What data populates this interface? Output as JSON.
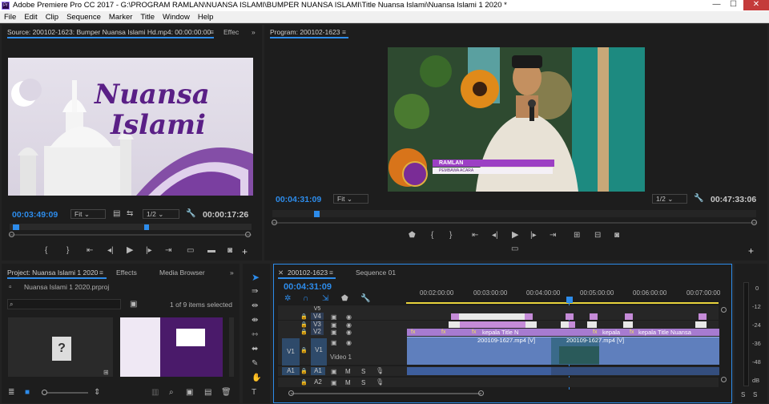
{
  "window": {
    "title": "Adobe Premiere Pro CC 2017 - G:\\PROGRAM RAMLAN\\NUANSA ISLAMI\\BUMPER NUANSA ISLAMI\\Title Nuansa Islami\\Nuansa Islami 1 2020 *",
    "minimize": "—",
    "maximize": "☐",
    "close": "✕",
    "icon": "Pr"
  },
  "menu": [
    "File",
    "Edit",
    "Clip",
    "Sequence",
    "Marker",
    "Title",
    "Window",
    "Help"
  ],
  "source": {
    "tab": "Source: 200102-1623: Bumper Nuansa Islami Hd.mp4: 00:00:00:00",
    "tab2": "Effec",
    "timecode": "00:03:49:09",
    "fit": "Fit",
    "resolution": "1/2",
    "duration": "00:00:17:26",
    "title_line1": "Nuansa",
    "title_line2": "Islami"
  },
  "program": {
    "tab": "Program: 200102-1623",
    "timecode": "00:04:31:09",
    "fit": "Fit",
    "resolution": "1/2",
    "duration": "00:47:33:06",
    "lower_third_name": "RAMLAN",
    "lower_third_role": "PEMBAWA ACARA"
  },
  "project": {
    "tab": "Project: Nuansa Islami 1 2020",
    "tabs": [
      "Effects",
      "Media Browser"
    ],
    "file": "Nuansa Islami 1 2020.prproj",
    "item_count": "1 of 9 items selected",
    "search_placeholder": ""
  },
  "timeline": {
    "tab": "200102-1623",
    "tab2": "Sequence 01",
    "timecode": "00:04:31:09",
    "ruler": [
      "00:02:00:00",
      "00:03:00:00",
      "00:04:00:00",
      "00:05:00:00",
      "00:06:00:00",
      "00:07:00:00"
    ],
    "tracks": {
      "v5": "V5",
      "v4": "V4",
      "v3": "V3",
      "v2": "V2",
      "v1_src": "V1",
      "v1": "V1",
      "video1": "Video 1",
      "a1_src": "A1",
      "a1": "A1",
      "a2": "A2",
      "m": "M",
      "s": "S"
    },
    "clips": {
      "title_a": "kepala Title N",
      "title_b": "kepala",
      "title_c": "kepala Title Nuansa",
      "vid_a": "200109-1627.mp4 [V]",
      "vid_b": "200109-1627.mp4 [V]",
      "fx": "fx"
    }
  },
  "meter": {
    "labels": [
      "0",
      "-12",
      "-24",
      "-36",
      "-48",
      "dB"
    ]
  },
  "colors": {
    "accent": "#2d8ceb",
    "video_clip": "#5f7fbd",
    "title_clip": "#c58bd8",
    "audio_clip": "#3e5f9e"
  }
}
